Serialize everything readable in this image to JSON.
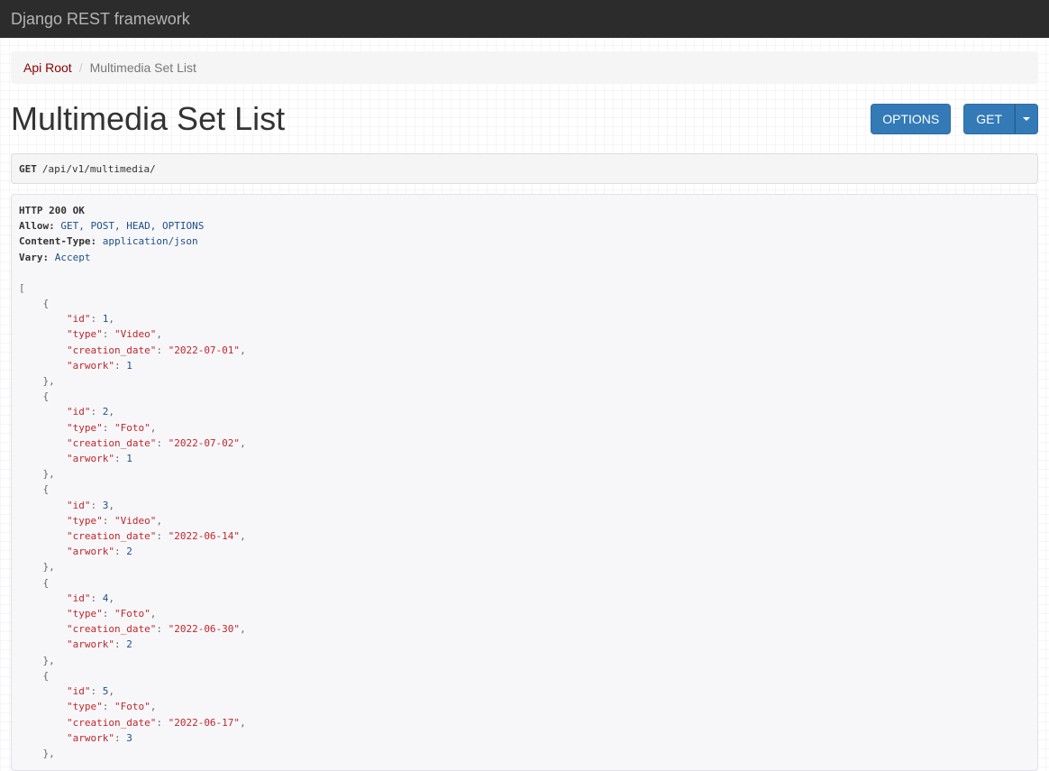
{
  "navbar": {
    "brand": "Django REST framework"
  },
  "breadcrumb": {
    "root": "Api Root",
    "separator": "/",
    "current": "Multimedia Set List"
  },
  "page": {
    "title": "Multimedia Set List"
  },
  "buttons": {
    "options": "OPTIONS",
    "get": "GET"
  },
  "request": {
    "method": "GET",
    "path": "/api/v1/multimedia/"
  },
  "response": {
    "status": "HTTP 200 OK",
    "headers": [
      {
        "key": "Allow:",
        "value": "GET, POST, HEAD, OPTIONS"
      },
      {
        "key": "Content-Type:",
        "value": "application/json"
      },
      {
        "key": "Vary:",
        "value": "Accept"
      }
    ],
    "items": [
      {
        "id": "1",
        "type": "\"Video\"",
        "creation_date": "\"2022-07-01\"",
        "arwork": "1"
      },
      {
        "id": "2",
        "type": "\"Foto\"",
        "creation_date": "\"2022-07-02\"",
        "arwork": "1"
      },
      {
        "id": "3",
        "type": "\"Video\"",
        "creation_date": "\"2022-06-14\"",
        "arwork": "2"
      },
      {
        "id": "4",
        "type": "\"Foto\"",
        "creation_date": "\"2022-06-30\"",
        "arwork": "2"
      },
      {
        "id": "5",
        "type": "\"Foto\"",
        "creation_date": "\"2022-06-17\"",
        "arwork": "3"
      }
    ],
    "keys": {
      "id": "\"id\"",
      "type": "\"type\"",
      "creation_date": "\"creation_date\"",
      "arwork": "\"arwork\""
    },
    "brackets": {
      "open_array": "[",
      "open_obj": "{",
      "close_obj": "},",
      "colon": ": ",
      "comma": ","
    }
  },
  "colors": {
    "navbar": "#2c2c2c",
    "button": "#337ab7",
    "link": "#8b0000"
  }
}
